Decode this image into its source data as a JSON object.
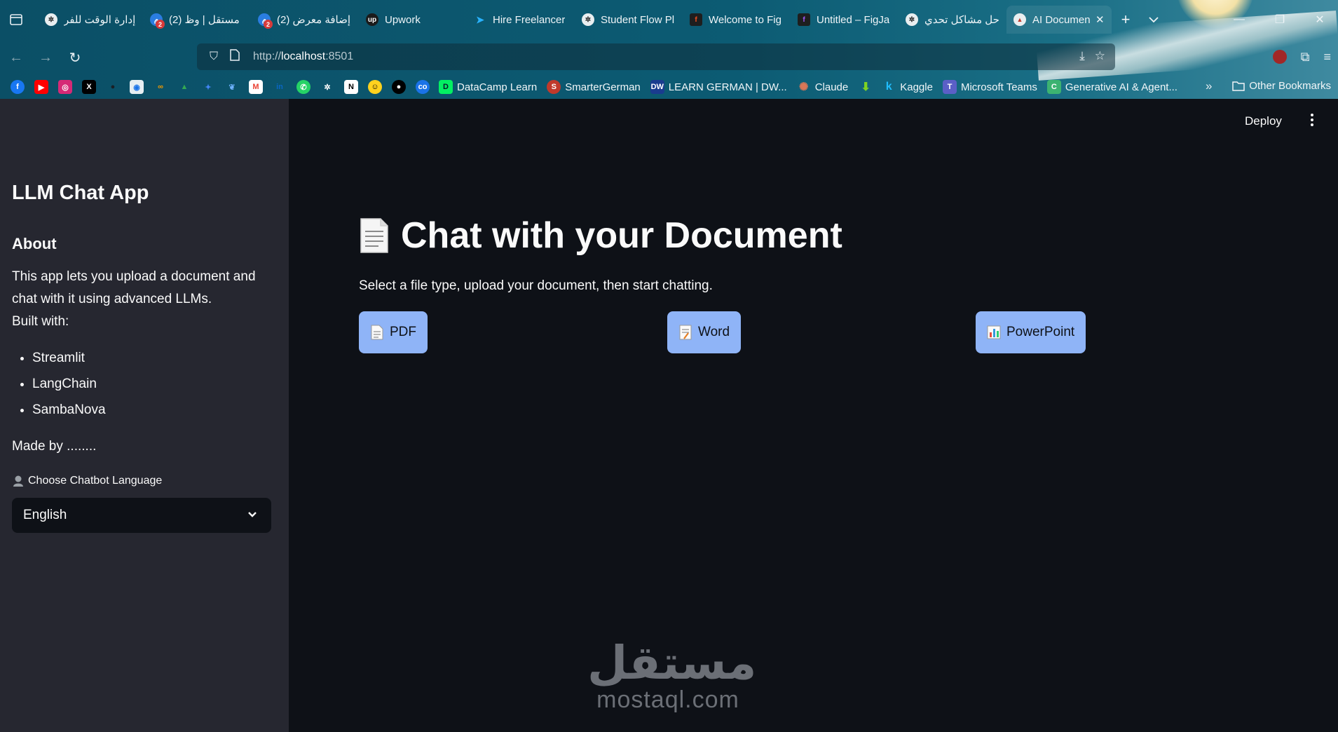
{
  "browser": {
    "tabs": [
      {
        "label": "إدارة الوقت للفر",
        "icon": "chatgpt-icon",
        "badge": ""
      },
      {
        "label": "(2) مستقل | وظ",
        "icon": "mostaql-icon",
        "badge": "2"
      },
      {
        "label": "(2) إضافة معرض",
        "icon": "mostaql-icon",
        "badge": "2"
      },
      {
        "label": "Upwork",
        "icon": "upwork-icon",
        "badge": ""
      },
      {
        "label": "Hire Freelancer",
        "icon": "freelancer-icon",
        "badge": ""
      },
      {
        "label": "Student Flow Pl",
        "icon": "chatgpt-icon",
        "badge": ""
      },
      {
        "label": "Welcome to Fig",
        "icon": "figma-icon",
        "badge": ""
      },
      {
        "label": "Untitled – FigJa",
        "icon": "figjam-icon",
        "badge": ""
      },
      {
        "label": "حل مشاكل تحدي",
        "icon": "chatgpt-icon",
        "badge": ""
      },
      {
        "label": "AI Documen",
        "icon": "streamlit-icon",
        "badge": ""
      }
    ],
    "url_prefix": "http://",
    "url_host": "localhost",
    "url_suffix": ":8501",
    "bookmarks": [
      {
        "label": "DataCamp Learn",
        "icon": "datacamp-icon",
        "color": "#03ef62"
      },
      {
        "label": "SmarterGerman",
        "icon": "smartergerman-icon",
        "color": "#c0392b"
      },
      {
        "label": "LEARN GERMAN | DW...",
        "icon": "dw-icon",
        "color": "#1a3c8f"
      },
      {
        "label": "Claude",
        "icon": "claude-icon",
        "color": "#d97757"
      },
      {
        "label": "Kaggle",
        "icon": "kaggle-icon",
        "color": "#20beff"
      },
      {
        "label": "Microsoft Teams",
        "icon": "teams-icon",
        "color": "#5b5fc7"
      },
      {
        "label": "Generative AI & Agent...",
        "icon": "coursera-icon",
        "color": "#3cb371"
      }
    ],
    "other_bookmarks": "Other Bookmarks"
  },
  "sidebar": {
    "title": "LLM Chat App",
    "about_heading": "About",
    "about_line1": "This app lets you upload a document and chat with it using advanced LLMs.",
    "about_line2": "Built with:",
    "built_with": [
      "Streamlit",
      "LangChain",
      "SambaNova"
    ],
    "made_by": "Made by ........",
    "language_label": "Choose Chatbot Language",
    "language_value": "English"
  },
  "header": {
    "deploy_label": "Deploy"
  },
  "main": {
    "title": "Chat with your Document",
    "subtitle": "Select a file type, upload your document, then start chatting.",
    "file_types": [
      {
        "label": "PDF",
        "icon": "page-icon"
      },
      {
        "label": "Word",
        "icon": "memo-icon"
      },
      {
        "label": "PowerPoint",
        "icon": "bar-chart-icon"
      }
    ]
  },
  "watermark": {
    "logo_text": "مستقل",
    "url": "mostaql.com"
  }
}
